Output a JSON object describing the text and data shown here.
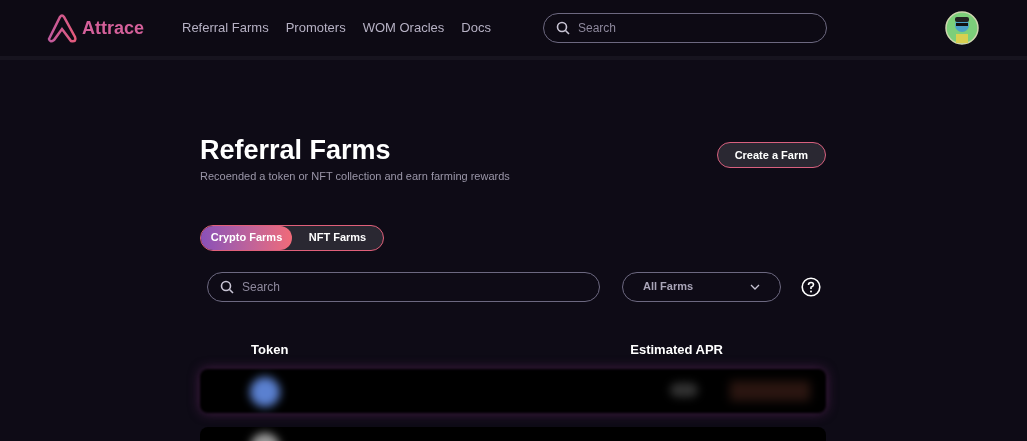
{
  "logo": {
    "text": "Attrace"
  },
  "nav": [
    {
      "label": "Referral Farms"
    },
    {
      "label": "Promoters"
    },
    {
      "label": "WOM Oracles"
    },
    {
      "label": "Docs"
    }
  ],
  "header_search": {
    "placeholder": "Search"
  },
  "page": {
    "title": "Referral Farms",
    "subtitle": "Recoended a token or NFT collection and earn farming rewards",
    "create_button": "Create a Farm"
  },
  "tabs": [
    {
      "label": "Crypto Farms",
      "selected": true
    },
    {
      "label": "NFT Farms",
      "selected": false
    }
  ],
  "search": {
    "placeholder": "Search"
  },
  "filter": {
    "value": "All Farms"
  },
  "table": {
    "columns": [
      "Token",
      "Estimated APR"
    ]
  }
}
